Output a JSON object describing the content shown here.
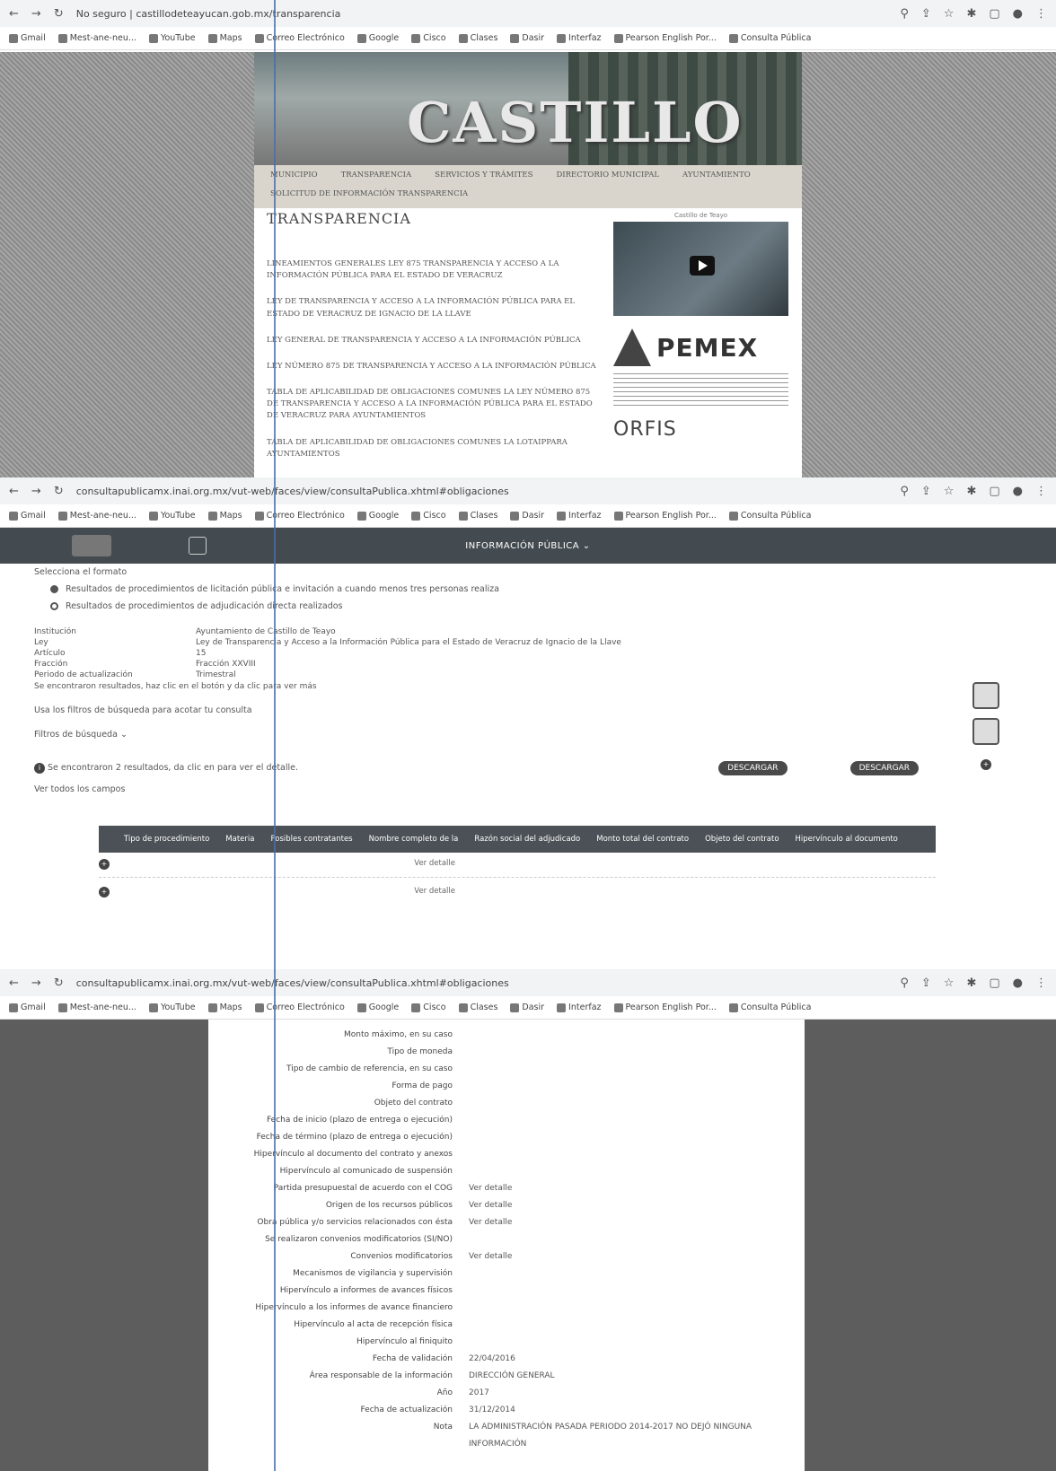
{
  "panel1": {
    "url": "No seguro | castillodeteayucan.gob.mx/transparencia",
    "bookmarks": [
      "Gmail",
      "Mest-ane-neu...",
      "YouTube",
      "Maps",
      "Correo Electrónico",
      "Google",
      "Cisco",
      "Clases",
      "Dasir",
      "Interfaz",
      "Pearson English Por...",
      "Consulta Pública"
    ],
    "banner_word": "CASTILLO",
    "nav": [
      "MUNICIPIO",
      "TRANSPARENCIA",
      "SERVICIOS Y TRÁMITES",
      "DIRECTORIO MUNICIPAL",
      "AYUNTAMIENTO",
      "SOLICITUD DE INFORMACIÓN TRANSPARENCIA"
    ],
    "title": "TRANSPARENCIA",
    "links": [
      "LINEAMIENTOS GENERALES LEY 875 TRANSPARENCIA Y ACCESO A LA INFORMACIÓN PÚBLICA PARA EL ESTADO DE VERACRUZ",
      "LEY DE TRANSPARENCIA Y ACCESO A LA INFORMACIÓN PÚBLICA PARA EL ESTADO DE VERACRUZ DE IGNACIO DE LA LLAVE",
      "LEY GENERAL DE TRANSPARENCIA Y ACCESO A LA INFORMACIÓN PÚBLICA",
      "LEY NÚMERO 875 DE TRANSPARENCIA Y ACCESO A LA INFORMACIÓN PÚBLICA",
      "TABLA DE APLICABILIDAD DE OBLIGACIONES COMUNES LA LEY NÚMERO 875 DE TRANSPARENCIA Y ACCESO A LA INFORMACIÓN PÚBLICA PARA EL ESTADO DE VERACRUZ PARA AYUNTAMIENTOS",
      "TABLA DE APLICABILIDAD DE OBLIGACIONES COMUNES LA LOTAIPPARA AYUNTAMIENTOS"
    ],
    "video_caption": "Castillo de Teayo",
    "pemex": "PEMEX",
    "orfis": "ORFIS"
  },
  "panel2": {
    "url": "consultapublicamx.inai.org.mx/vut-web/faces/view/consultaPublica.xhtml#obligaciones",
    "banner": "INFORMACIÓN PÚBLICA",
    "select_format": "Selecciona el formato",
    "options": [
      "Resultados de procedimientos de licitación pública e invitación a cuando menos tres personas realiza",
      "Resultados de procedimientos de adjudicación directa realizados"
    ],
    "fields": [
      {
        "k": "Institución",
        "v": "Ayuntamiento de Castillo de Teayo"
      },
      {
        "k": "Ley",
        "v": "Ley de Transparencia y Acceso a la Información Pública para el Estado de Veracruz de Ignacio de la Llave"
      },
      {
        "k": "Artículo",
        "v": "15"
      },
      {
        "k": "Fracción",
        "v": "Fracción XXVIII"
      },
      {
        "k": "Periodo de actualización",
        "v": "Trimestral"
      }
    ],
    "note": "Se encontraron resultados, haz clic en el botón y da clic para ver más",
    "search_hint": "Usa los filtros de búsqueda para acotar tu consulta",
    "filters": "Filtros de búsqueda",
    "found": "Se encontraron 2 resultados, da clic en para ver el detalle.",
    "see_all": "Ver todos los campos",
    "btn_download": "DESCARGAR",
    "btn_download2": "DESCARGAR",
    "columns": [
      "Tipo de procedimiento",
      "Materia",
      "Posibles contratantes",
      "Nombre completo de la",
      "Razón social del adjudicado",
      "Monto total del contrato",
      "Objeto del contrato",
      "Hipervínculo al documento"
    ],
    "rows": [
      "Ver detalle",
      "Ver detalle"
    ]
  },
  "panel3": {
    "url": "consultapublicamx.inai.org.mx/vut-web/faces/view/consultaPublica.xhtml#obligaciones",
    "details": [
      {
        "k": "Monto máximo, en su caso",
        "v": ""
      },
      {
        "k": "Tipo de moneda",
        "v": ""
      },
      {
        "k": "Tipo de cambio de referencia, en su caso",
        "v": ""
      },
      {
        "k": "Forma de pago",
        "v": ""
      },
      {
        "k": "Objeto del contrato",
        "v": ""
      },
      {
        "k": "Fecha de inicio (plazo de entrega o ejecución)",
        "v": ""
      },
      {
        "k": "Fecha de término (plazo de entrega o ejecución)",
        "v": ""
      },
      {
        "k": "Hipervínculo al documento del contrato y anexos",
        "v": ""
      },
      {
        "k": "Hipervínculo al comunicado de suspensión",
        "v": ""
      },
      {
        "k": "Partida presupuestal de acuerdo con el COG",
        "v": "Ver detalle"
      },
      {
        "k": "Origen de los recursos públicos",
        "v": "Ver detalle"
      },
      {
        "k": "Obra pública y/o servicios relacionados con ésta",
        "v": "Ver detalle"
      },
      {
        "k": "Se realizaron convenios modificatorios (SI/NO)",
        "v": ""
      },
      {
        "k": "Convenios modificatorios",
        "v": "Ver detalle"
      },
      {
        "k": "Mecanismos de vigilancia y supervisión",
        "v": ""
      },
      {
        "k": "Hipervínculo a informes de avances físicos",
        "v": ""
      },
      {
        "k": "Hipervínculo a los informes de avance financiero",
        "v": ""
      },
      {
        "k": "Hipervínculo al acta de recepción física",
        "v": ""
      },
      {
        "k": "Hipervínculo al finiquito",
        "v": ""
      },
      {
        "k": "Fecha de validación",
        "v": "22/04/2016"
      },
      {
        "k": "Área responsable de la información",
        "v": "DIRECCIÓN GENERAL"
      },
      {
        "k": "Año",
        "v": "2017"
      },
      {
        "k": "Fecha de actualización",
        "v": "31/12/2014"
      },
      {
        "k": "Nota",
        "v": "LA ADMINISTRACIÓN PASADA PERIODO 2014-2017 NO DEJÓ NINGUNA INFORMACIÓN"
      }
    ]
  }
}
